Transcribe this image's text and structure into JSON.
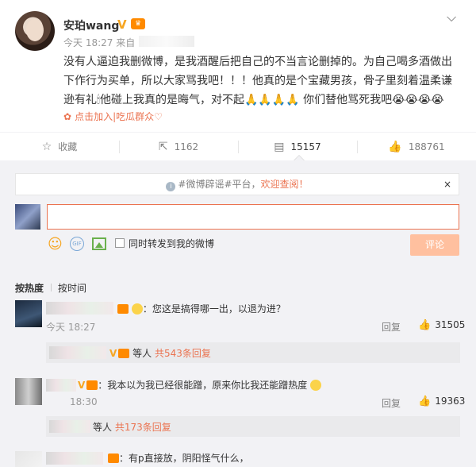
{
  "post": {
    "username": "安珀wang",
    "time": "今天 18:27 来自",
    "content": "没有人逼迫我删微博，是我酒醒后把自己的不当言论删掉的。为自己喝多酒做出下作行为买单，所以大家骂我吧！！！他真的是个宝藏男孩，骨子里刻着温柔谦逊有礼🕯他碰上我真的是晦气，对不起🙏🙏🙏🙏 你们替他骂死我吧😭😭😭😭",
    "fan_link": "点击加入|吃瓜群众♡"
  },
  "actions": {
    "favorite": "收藏",
    "repost": "1162",
    "comment": "15157",
    "like": "188761"
  },
  "notice": {
    "prefix": "#微博辟谣#平台，",
    "highlight": "欢迎查阅！",
    "close": "×"
  },
  "composer": {
    "repost_label": "同时转发到我的微博",
    "submit": "评论",
    "gif": "GIF"
  },
  "sort": {
    "hot": "按热度",
    "time": "按时间"
  },
  "comments": [
    {
      "text": "：您这是搞得哪一出，以退为进？",
      "time": "今天 18:27",
      "reply": "回复",
      "likes": "31505",
      "sub": {
        "name": "等人",
        "count": "共543条回复"
      }
    },
    {
      "text": "：我本以为我已经很能蹭，原来你比我还能蹭热度",
      "time": "18:30",
      "reply": "回复",
      "likes": "19363",
      "sub": {
        "name": "等人",
        "count": "共173条回复"
      }
    },
    {
      "text": "：有p直接放，阴阳怪气什么，"
    }
  ]
}
